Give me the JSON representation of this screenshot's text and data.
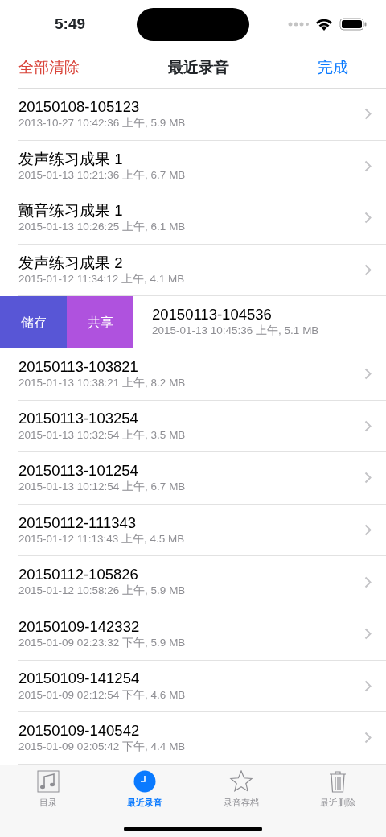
{
  "status_bar": {
    "time": "5:49"
  },
  "nav": {
    "left": "全部清除",
    "title": "最近录音",
    "right": "完成"
  },
  "rows": [
    {
      "title": "20150108-105123",
      "subtitle": "2013-10-27 10:42:36 上午, 5.9 MB",
      "swiped": false
    },
    {
      "title": "发声练习成果 1",
      "subtitle": "2015-01-13 10:21:36 上午, 6.7 MB",
      "swiped": false
    },
    {
      "title": "颤音练习成果 1",
      "subtitle": "2015-01-13 10:26:25 上午, 6.1 MB",
      "swiped": false
    },
    {
      "title": "发声练习成果 2",
      "subtitle": "2015-01-12 11:34:12 上午, 4.1 MB",
      "swiped": false
    },
    {
      "title": "20150113-104536",
      "subtitle": "2015-01-13 10:45:36 上午, 5.1 MB",
      "swiped": true,
      "actions": [
        {
          "label": "储存",
          "color": "#5856d6"
        },
        {
          "label": "共享",
          "color": "#af52de"
        }
      ]
    },
    {
      "title": "20150113-103821",
      "subtitle": "2015-01-13 10:38:21 上午, 8.2 MB",
      "swiped": false
    },
    {
      "title": "20150113-103254",
      "subtitle": "2015-01-13 10:32:54 上午, 3.5 MB",
      "swiped": false
    },
    {
      "title": "20150113-101254",
      "subtitle": "2015-01-13 10:12:54 上午, 6.7 MB",
      "swiped": false
    },
    {
      "title": "20150112-111343",
      "subtitle": "2015-01-12 11:13:43 上午, 4.5 MB",
      "swiped": false
    },
    {
      "title": "20150112-105826",
      "subtitle": "2015-01-12 10:58:26 上午, 5.9 MB",
      "swiped": false
    },
    {
      "title": "20150109-142332",
      "subtitle": "2015-01-09 02:23:32 下午, 5.9 MB",
      "swiped": false
    },
    {
      "title": "20150109-141254",
      "subtitle": "2015-01-09 02:12:54 下午, 4.6 MB",
      "swiped": false
    },
    {
      "title": "20150109-140542",
      "subtitle": "2015-01-09 02:05:42 下午, 4.4 MB",
      "swiped": false
    }
  ],
  "tab_bar": [
    {
      "label": "目录",
      "kind": "sheet",
      "selected": false
    },
    {
      "label": "最近录音",
      "kind": "clock",
      "selected": true
    },
    {
      "label": "录音存档",
      "kind": "star",
      "selected": false
    },
    {
      "label": "最近删除",
      "kind": "trash",
      "selected": false
    }
  ]
}
